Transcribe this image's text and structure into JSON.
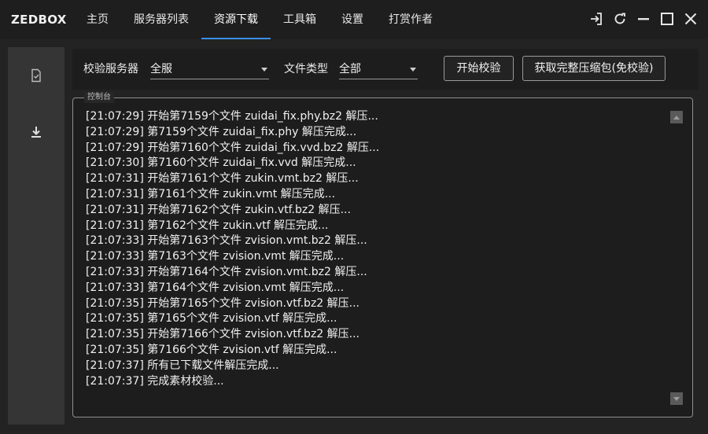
{
  "app": {
    "brand": "ZEDBOX"
  },
  "nav": {
    "tabs": [
      {
        "label": "主页",
        "active": false
      },
      {
        "label": "服务器列表",
        "active": false
      },
      {
        "label": "资源下载",
        "active": true
      },
      {
        "label": "工具箱",
        "active": false
      },
      {
        "label": "设置",
        "active": false
      },
      {
        "label": "打赏作者",
        "active": false
      }
    ]
  },
  "window_controls": [
    "login-icon",
    "refresh-icon",
    "minimize-icon",
    "maximize-icon",
    "close-icon"
  ],
  "sidebar": {
    "items": [
      {
        "icon": "document-check-icon"
      },
      {
        "icon": "download-icon"
      }
    ]
  },
  "toolbar": {
    "server_label": "校验服务器",
    "server_value": "全服",
    "type_label": "文件类型",
    "type_value": "全部",
    "verify_button": "开始校验",
    "full_package_button": "获取完整压缩包(免校验)"
  },
  "console": {
    "title": "控制台",
    "lines": [
      "[21:07:29] 开始第7159个文件 zuidai_fix.phy.bz2 解压...",
      "[21:07:29] 第7159个文件 zuidai_fix.phy 解压完成...",
      "[21:07:29] 开始第7160个文件 zuidai_fix.vvd.bz2 解压...",
      "[21:07:30] 第7160个文件 zuidai_fix.vvd 解压完成...",
      "[21:07:31] 开始第7161个文件 zukin.vmt.bz2 解压...",
      "[21:07:31] 第7161个文件 zukin.vmt 解压完成...",
      "[21:07:31] 开始第7162个文件 zukin.vtf.bz2 解压...",
      "[21:07:31] 第7162个文件 zukin.vtf 解压完成...",
      "[21:07:33] 开始第7163个文件 zvision.vmt.bz2 解压...",
      "[21:07:33] 第7163个文件 zvision.vmt 解压完成...",
      "[21:07:33] 开始第7164个文件 zvision.vmt.bz2 解压...",
      "[21:07:33] 第7164个文件 zvision.vmt 解压完成...",
      "[21:07:35] 开始第7165个文件 zvision.vtf.bz2 解压...",
      "[21:07:35] 第7165个文件 zvision.vtf 解压完成...",
      "[21:07:35] 开始第7166个文件 zvision.vtf.bz2 解压...",
      "[21:07:35] 第7166个文件 zvision.vtf 解压完成...",
      "[21:07:37] 所有已下载文件解压完成...",
      "[21:07:37] 完成素材校验..."
    ]
  },
  "colors": {
    "accent": "#3a8ee6",
    "text": "#f1f1f1",
    "border": "#8f8f8f"
  }
}
